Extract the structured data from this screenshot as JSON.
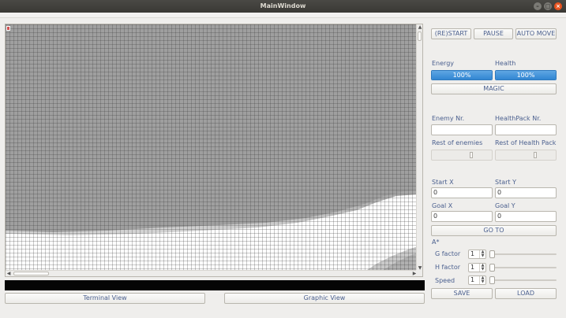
{
  "window": {
    "title": "MainWindow",
    "controls": {
      "minimize_icon": "minimize-icon",
      "maximize_icon": "maximize-icon",
      "close_icon": "close-icon"
    }
  },
  "scene": {
    "protagonist_icon": "protagonist-icon",
    "scroll_up": "▲",
    "scroll_down": "▼",
    "scroll_left": "◀",
    "scroll_right": "▶"
  },
  "bottom_tabs": {
    "terminal": "Terminal View",
    "graphic": "Graphic View"
  },
  "controls": {
    "restart": "(RE)START",
    "pause": "PAUSE",
    "auto_move": "AUTO MOVE",
    "energy_label": "Energy",
    "energy_value": "100%",
    "energy_fraction": 1.0,
    "health_label": "Health",
    "health_value": "100%",
    "health_fraction": 1.0,
    "magic": "MAGIC",
    "enemy_nr_label": "Enemy Nr.",
    "enemy_nr_value": "",
    "healthpack_nr_label": "HealthPack Nr.",
    "healthpack_nr_value": "",
    "rest_enemies_label": "Rest of enemies",
    "rest_healthpack_label": "Rest of Health Pack",
    "start_x_label": "Start X",
    "start_x_value": "0",
    "start_y_label": "Start Y",
    "start_y_value": "0",
    "goal_x_label": "Goal X",
    "goal_x_value": "0",
    "goal_y_label": "Goal Y",
    "goal_y_value": "0",
    "go_to": "GO TO",
    "astar_label": "A*",
    "g_factor_label": "G factor",
    "g_factor_value": "1",
    "h_factor_label": "H factor",
    "h_factor_value": "1",
    "speed_label": "Speed",
    "speed_value": "1",
    "save": "SAVE",
    "load": "LOAD"
  },
  "colors": {
    "accent": "#3286d2",
    "label": "#4a5f8e",
    "terminal": "#050505"
  }
}
